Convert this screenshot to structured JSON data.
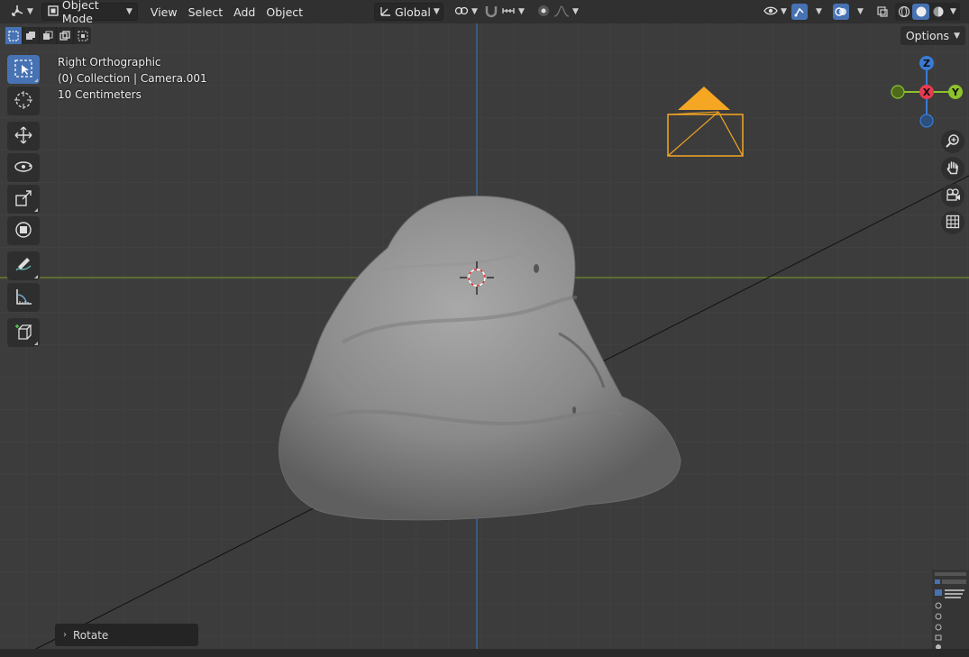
{
  "header": {
    "editor_type_icon": "axis-editor-icon",
    "mode": "Object Mode",
    "menus": [
      "View",
      "Select",
      "Add",
      "Object"
    ],
    "transform_orientation": "Global",
    "pivot_icon": "link-pivot-icon",
    "snap_icon": "magnet-icon",
    "proportional_icon": "proportional-edit-icon",
    "visibility_icon": "eye-icon",
    "gizmo_icon": "gizmo-icon",
    "overlay_icon": "overlay-icon",
    "xray_icon": "xray-icon",
    "shading_modes": [
      "wireframe",
      "solid",
      "material"
    ]
  },
  "subheader": {
    "options_label": "Options",
    "selection_modes": [
      "set",
      "extend",
      "subtract",
      "difference",
      "intersect"
    ]
  },
  "toolbar": {
    "tools": [
      "select-box",
      "cursor",
      "move",
      "rotate",
      "scale",
      "transform",
      "annotate",
      "measure",
      "add-cube"
    ],
    "active": "select-box"
  },
  "viewport_info": {
    "view_name": "Right Orthographic",
    "collection": "(0) Collection | Camera.001",
    "scale": "10 Centimeters"
  },
  "gizmo": {
    "axes": [
      "Z",
      "X",
      "Y"
    ],
    "colors": {
      "x": "#e83a52",
      "y": "#8cc22a",
      "z": "#3b7bd6"
    }
  },
  "nav_buttons": [
    "zoom-icon",
    "pan-hand-icon",
    "camera-view-icon",
    "grid-ortho-icon"
  ],
  "operator_panel": {
    "label": "Rotate"
  },
  "colors": {
    "header_bg": "#303030",
    "viewport_bg": "#3c3c3c",
    "accent": "#4772b3",
    "camera": "#f5a623",
    "mesh": "#8a8a8a"
  }
}
